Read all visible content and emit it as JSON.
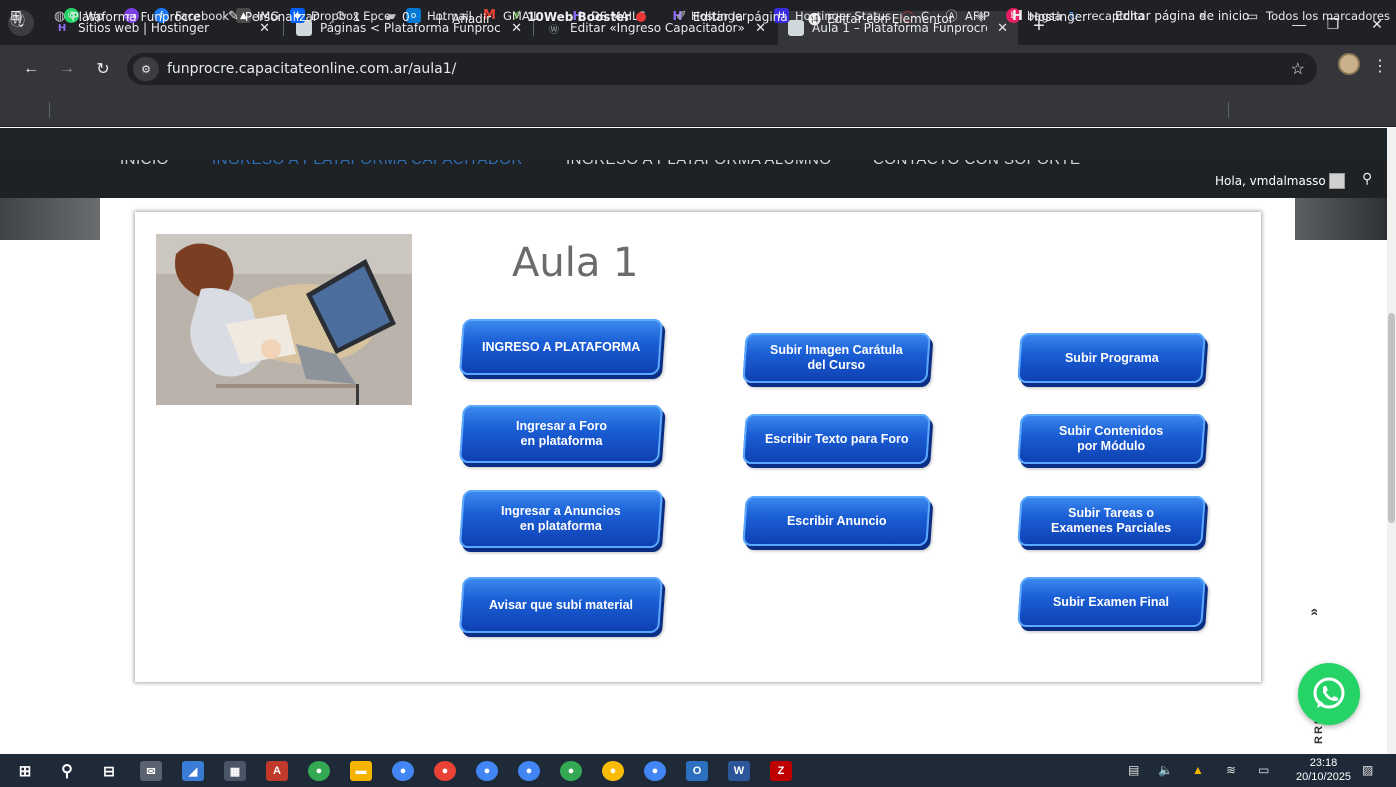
{
  "browser": {
    "tabs": [
      {
        "title": "Sitios web | Hostinger",
        "icon": "hostinger-icon",
        "active": false
      },
      {
        "title": "Páginas < Plataforma Funprocre",
        "icon": "site-favicon",
        "active": false
      },
      {
        "title": "Editar «Ingreso Capacitador» co",
        "icon": "wordpress-icon",
        "active": false
      },
      {
        "title": "Aula 1 – Plataforma Funprocre",
        "icon": "site-favicon",
        "active": true
      }
    ],
    "new_tab": "+",
    "url": "funprocre.capacitateonline.com.ar/aula1/"
  },
  "bookmarks": [
    {
      "label": "Wp",
      "icon": "whatsapp-icon",
      "color": "#25d366"
    },
    {
      "label": "",
      "icon": "zoom-icon",
      "color": "#7b3fe4"
    },
    {
      "label": "Facebook",
      "icon": "facebook-icon",
      "color": "#1877f2"
    },
    {
      "label": "IMG",
      "icon": "image-icon",
      "color": "#4a4a4a"
    },
    {
      "label": "Dropbox Epce",
      "icon": "dropbox-icon",
      "color": "#0061fe"
    },
    {
      "label": "Hotmail",
      "icon": "outlook-icon",
      "color": "#0078d4"
    },
    {
      "label": "GMAIL",
      "icon": "gmail-icon",
      "color": "#ea4335"
    },
    {
      "label": "DS MAILS",
      "icon": "hostinger-icon",
      "color": "#673de6"
    },
    {
      "label": "Hostinger",
      "icon": "hostinger-icon",
      "color": "#673de6"
    },
    {
      "label": "Hostinger Status",
      "icon": "hostinger-icon",
      "color": "#3a2ee0"
    },
    {
      "label": "C",
      "icon": "spinner-icon",
      "color": "#e53935"
    },
    {
      "label": "AFIP",
      "icon": "afip-icon",
      "color": "#5f6368"
    },
    {
      "label": "bagsa",
      "icon": "bagsa-icon",
      "color": "#e91e63"
    },
    {
      "label": "recaptcha",
      "icon": "recaptcha-icon",
      "color": "#4a90e2"
    }
  ],
  "bookmarks_more": "»",
  "bookmarks_all": "Todos los marcadores",
  "wp_admin": {
    "site": "Plataforma Funprocre",
    "customize": "Personalizar",
    "updates": "1",
    "comments": "0",
    "add": "Añadir",
    "booster": "10Web Booster",
    "edit_page": "Editar la página",
    "elementor": "Editar con Elementor",
    "hostinger": "Hostinger",
    "edit_home": "Editar página de inicio"
  },
  "site_menu": {
    "items": [
      "INICIO",
      "INGRESO A PLATAFORMA CAPACITADOR",
      "INGRESO A PLATAFORMA ALUMNO",
      "CONTACTO CON SOPORTE"
    ],
    "greeting": "Hola, vmdalmasso"
  },
  "page": {
    "title": "Aula 1",
    "buttons": {
      "ingreso_plataforma": "INGRESO A PLATAFORMA",
      "subir_imagen": "Subir Imagen Carátula\ndel Curso",
      "subir_programa": "Subir Programa",
      "ingresar_foro": "Ingresar a Foro\nen plataforma",
      "escribir_foro": "Escribir Texto para Foro",
      "subir_contenidos": "Subir Contenidos\npor Módulo",
      "ingresar_anuncios": "Ingresar a Anuncios\nen plataforma",
      "escribir_anuncio": "Escribir Anuncio",
      "subir_tareas": "Subir Tareas o\nExamenes Parciales",
      "avisar_material": "Avisar que subí material",
      "subir_examen": "Subir Examen Final"
    },
    "scroll_top": "VOLVER ARRIBA",
    "scroll_top_visible": "RRIBA"
  },
  "taskbar": {
    "time": "23:18",
    "date": "20/10/2025"
  },
  "colors": {
    "button_top": "#3f8cf0",
    "button_bottom": "#0d3fb0",
    "title": "#6b6b6b",
    "menu_active": "#2f6fb5",
    "whatsapp": "#25d366"
  }
}
